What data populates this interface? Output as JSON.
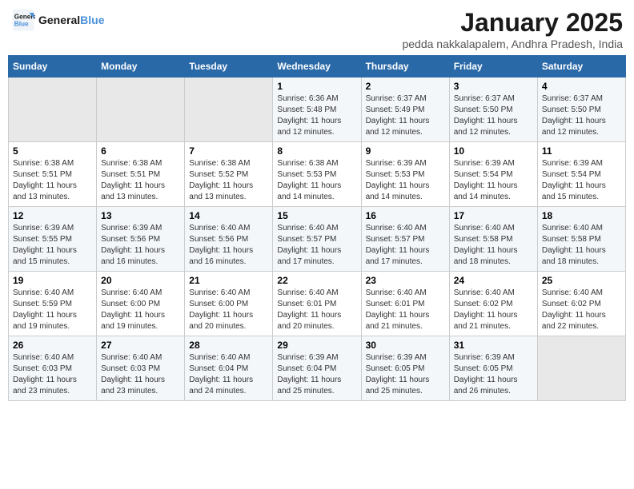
{
  "header": {
    "logo_line1": "General",
    "logo_line2": "Blue",
    "month": "January 2025",
    "location": "pedda nakkalapalem, Andhra Pradesh, India"
  },
  "weekdays": [
    "Sunday",
    "Monday",
    "Tuesday",
    "Wednesday",
    "Thursday",
    "Friday",
    "Saturday"
  ],
  "weeks": [
    [
      {
        "day": "",
        "info": ""
      },
      {
        "day": "",
        "info": ""
      },
      {
        "day": "",
        "info": ""
      },
      {
        "day": "1",
        "info": "Sunrise: 6:36 AM\nSunset: 5:48 PM\nDaylight: 11 hours and 12 minutes."
      },
      {
        "day": "2",
        "info": "Sunrise: 6:37 AM\nSunset: 5:49 PM\nDaylight: 11 hours and 12 minutes."
      },
      {
        "day": "3",
        "info": "Sunrise: 6:37 AM\nSunset: 5:50 PM\nDaylight: 11 hours and 12 minutes."
      },
      {
        "day": "4",
        "info": "Sunrise: 6:37 AM\nSunset: 5:50 PM\nDaylight: 11 hours and 12 minutes."
      }
    ],
    [
      {
        "day": "5",
        "info": "Sunrise: 6:38 AM\nSunset: 5:51 PM\nDaylight: 11 hours and 13 minutes."
      },
      {
        "day": "6",
        "info": "Sunrise: 6:38 AM\nSunset: 5:51 PM\nDaylight: 11 hours and 13 minutes."
      },
      {
        "day": "7",
        "info": "Sunrise: 6:38 AM\nSunset: 5:52 PM\nDaylight: 11 hours and 13 minutes."
      },
      {
        "day": "8",
        "info": "Sunrise: 6:38 AM\nSunset: 5:53 PM\nDaylight: 11 hours and 14 minutes."
      },
      {
        "day": "9",
        "info": "Sunrise: 6:39 AM\nSunset: 5:53 PM\nDaylight: 11 hours and 14 minutes."
      },
      {
        "day": "10",
        "info": "Sunrise: 6:39 AM\nSunset: 5:54 PM\nDaylight: 11 hours and 14 minutes."
      },
      {
        "day": "11",
        "info": "Sunrise: 6:39 AM\nSunset: 5:54 PM\nDaylight: 11 hours and 15 minutes."
      }
    ],
    [
      {
        "day": "12",
        "info": "Sunrise: 6:39 AM\nSunset: 5:55 PM\nDaylight: 11 hours and 15 minutes."
      },
      {
        "day": "13",
        "info": "Sunrise: 6:39 AM\nSunset: 5:56 PM\nDaylight: 11 hours and 16 minutes."
      },
      {
        "day": "14",
        "info": "Sunrise: 6:40 AM\nSunset: 5:56 PM\nDaylight: 11 hours and 16 minutes."
      },
      {
        "day": "15",
        "info": "Sunrise: 6:40 AM\nSunset: 5:57 PM\nDaylight: 11 hours and 17 minutes."
      },
      {
        "day": "16",
        "info": "Sunrise: 6:40 AM\nSunset: 5:57 PM\nDaylight: 11 hours and 17 minutes."
      },
      {
        "day": "17",
        "info": "Sunrise: 6:40 AM\nSunset: 5:58 PM\nDaylight: 11 hours and 18 minutes."
      },
      {
        "day": "18",
        "info": "Sunrise: 6:40 AM\nSunset: 5:58 PM\nDaylight: 11 hours and 18 minutes."
      }
    ],
    [
      {
        "day": "19",
        "info": "Sunrise: 6:40 AM\nSunset: 5:59 PM\nDaylight: 11 hours and 19 minutes."
      },
      {
        "day": "20",
        "info": "Sunrise: 6:40 AM\nSunset: 6:00 PM\nDaylight: 11 hours and 19 minutes."
      },
      {
        "day": "21",
        "info": "Sunrise: 6:40 AM\nSunset: 6:00 PM\nDaylight: 11 hours and 20 minutes."
      },
      {
        "day": "22",
        "info": "Sunrise: 6:40 AM\nSunset: 6:01 PM\nDaylight: 11 hours and 20 minutes."
      },
      {
        "day": "23",
        "info": "Sunrise: 6:40 AM\nSunset: 6:01 PM\nDaylight: 11 hours and 21 minutes."
      },
      {
        "day": "24",
        "info": "Sunrise: 6:40 AM\nSunset: 6:02 PM\nDaylight: 11 hours and 21 minutes."
      },
      {
        "day": "25",
        "info": "Sunrise: 6:40 AM\nSunset: 6:02 PM\nDaylight: 11 hours and 22 minutes."
      }
    ],
    [
      {
        "day": "26",
        "info": "Sunrise: 6:40 AM\nSunset: 6:03 PM\nDaylight: 11 hours and 23 minutes."
      },
      {
        "day": "27",
        "info": "Sunrise: 6:40 AM\nSunset: 6:03 PM\nDaylight: 11 hours and 23 minutes."
      },
      {
        "day": "28",
        "info": "Sunrise: 6:40 AM\nSunset: 6:04 PM\nDaylight: 11 hours and 24 minutes."
      },
      {
        "day": "29",
        "info": "Sunrise: 6:39 AM\nSunset: 6:04 PM\nDaylight: 11 hours and 25 minutes."
      },
      {
        "day": "30",
        "info": "Sunrise: 6:39 AM\nSunset: 6:05 PM\nDaylight: 11 hours and 25 minutes."
      },
      {
        "day": "31",
        "info": "Sunrise: 6:39 AM\nSunset: 6:05 PM\nDaylight: 11 hours and 26 minutes."
      },
      {
        "day": "",
        "info": ""
      }
    ]
  ]
}
